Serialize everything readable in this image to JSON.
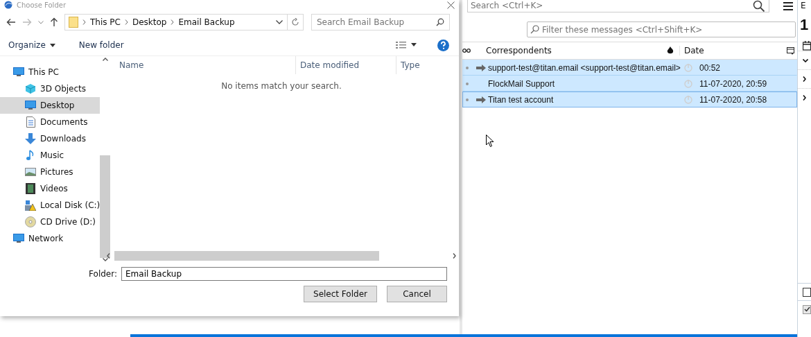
{
  "dialog": {
    "title": "Choose Folder",
    "breadcrumb": [
      "This PC",
      "Desktop",
      "Email Backup"
    ],
    "search": {
      "placeholder": "Search Email Backup"
    },
    "toolbar": [
      "Organize",
      "New folder"
    ],
    "nav_tree": [
      {
        "label": "This PC",
        "selected": false,
        "children": [
          {
            "label": "3D Objects",
            "selected": false
          },
          {
            "label": "Desktop",
            "selected": true
          },
          {
            "label": "Documents",
            "selected": false
          },
          {
            "label": "Downloads",
            "selected": false
          },
          {
            "label": "Music",
            "selected": false
          },
          {
            "label": "Pictures",
            "selected": false
          },
          {
            "label": "Videos",
            "selected": false
          },
          {
            "label": "Local Disk (C:)",
            "selected": false
          },
          {
            "label": "CD Drive (D:)",
            "selected": false
          }
        ]
      },
      {
        "label": "Network",
        "selected": false
      }
    ],
    "columns": [
      "Name",
      "Date modified",
      "Type"
    ],
    "empty_message": "No items match your search.",
    "folder_label": "Folder:",
    "folder_value": "Email Backup",
    "buttons": [
      "Select Folder",
      "Cancel"
    ]
  },
  "mail": {
    "search": {
      "placeholder": "Search <Ctrl+K>"
    },
    "filter": {
      "placeholder": "Filter these messages <Ctrl+Shift+K>"
    },
    "columns": [
      "Correspondents",
      "Date"
    ],
    "rows": [
      {
        "correspondent": "support-test@titan.email <support-test@titan.email>",
        "date": "00:52",
        "forwarded": true,
        "selected": true,
        "focused": false
      },
      {
        "correspondent": "FlockMail Support",
        "date": "11-07-2020, 20:59",
        "forwarded": false,
        "selected": true,
        "focused": false
      },
      {
        "correspondent": "Titan test account",
        "date": "11-07-2020, 20:58",
        "forwarded": true,
        "selected": true,
        "focused": true
      }
    ],
    "side_fragments": [
      "E",
      "1"
    ],
    "side_checkboxes": [
      {
        "checked": false
      },
      {
        "checked": true
      }
    ]
  }
}
